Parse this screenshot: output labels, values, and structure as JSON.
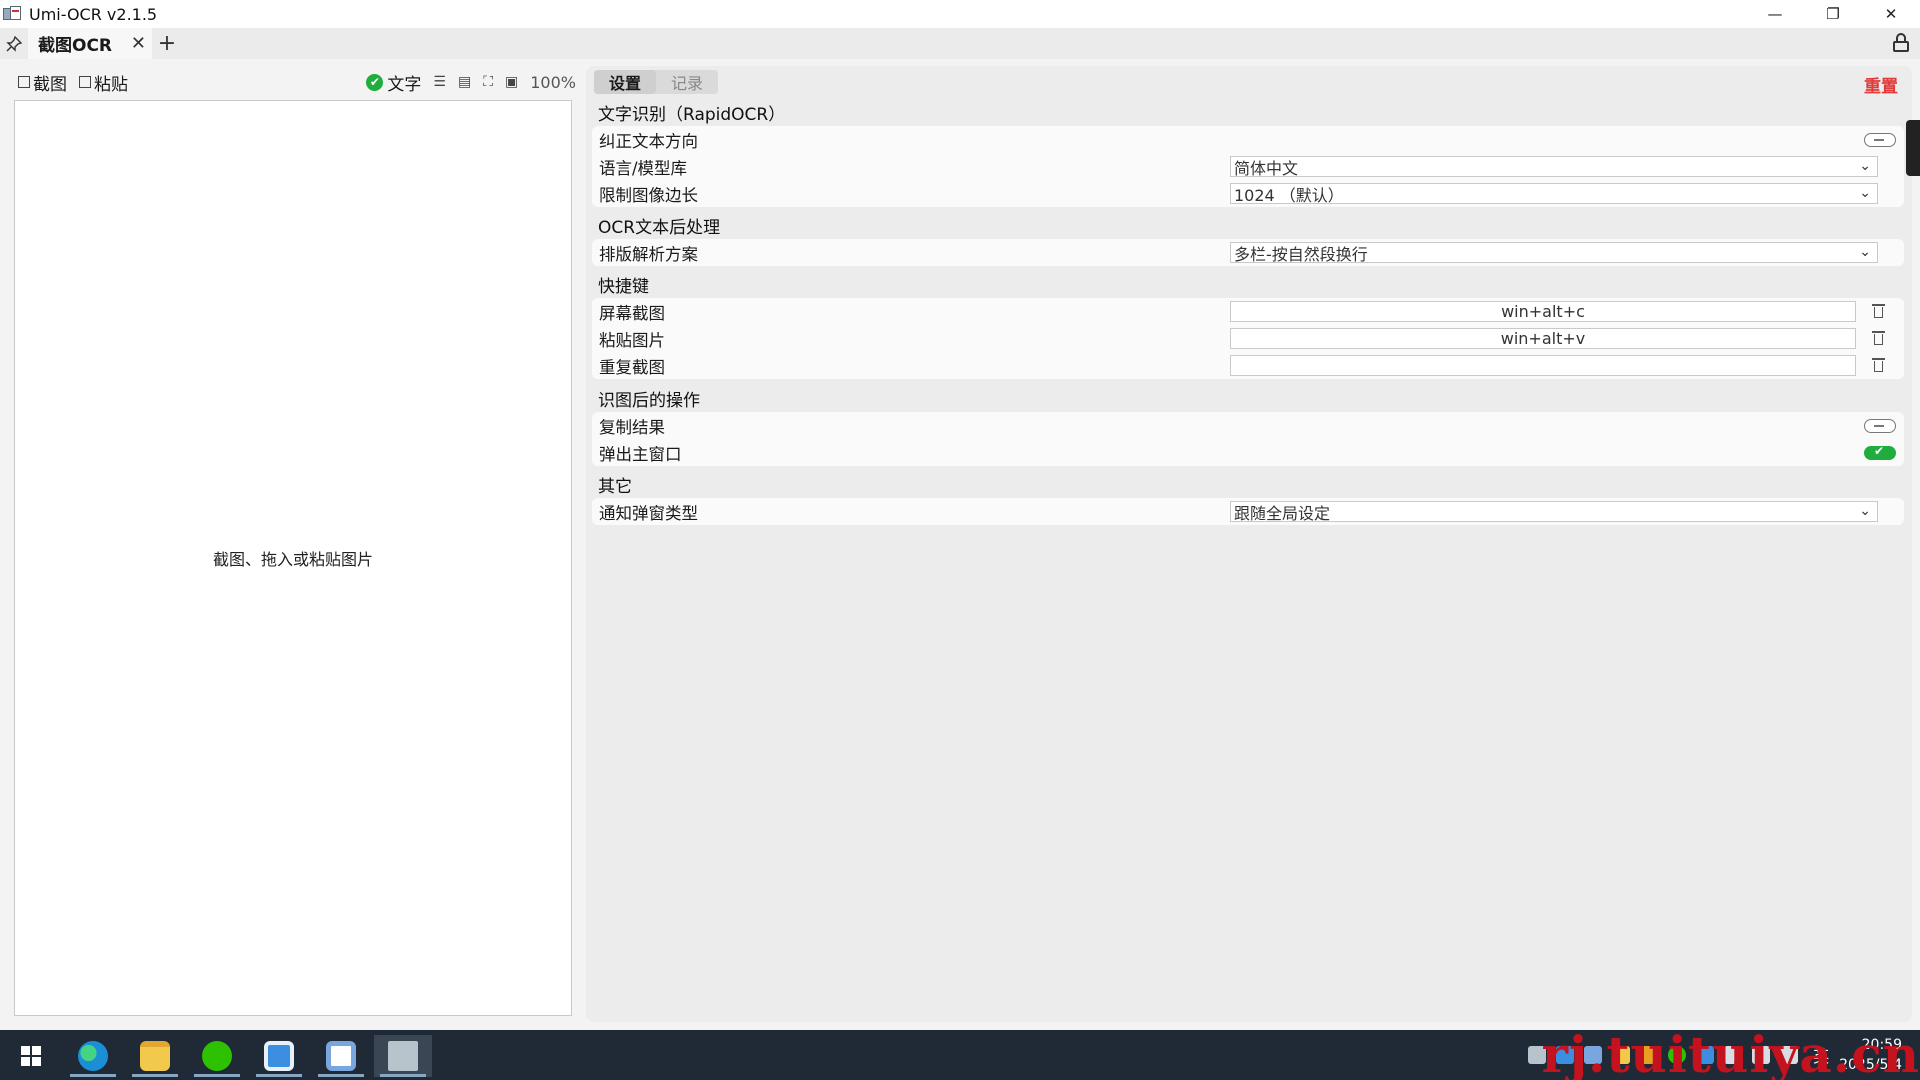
{
  "window": {
    "title": "Umi-OCR v2.1.5",
    "controls": {
      "minimize": "—",
      "restore": "❐",
      "close": "✕"
    }
  },
  "tabs": {
    "pin_icon": "📌",
    "active_tab": "截图OCR",
    "close_icon": "✕",
    "add_icon": "+"
  },
  "left": {
    "screenshot_label": "截图",
    "paste_label": "粘贴",
    "text_label": "文字",
    "zoom": "100%",
    "hint": "截图、拖入或粘贴图片"
  },
  "right": {
    "tab_settings": "设置",
    "tab_records": "记录",
    "reset": "重置",
    "sections": {
      "ocr": "文字识别（RapidOCR）",
      "post": "OCR文本后处理",
      "hotkeys": "快捷键",
      "after": "识图后的操作",
      "other": "其它"
    },
    "ocr": {
      "correct_dir_label": "纠正文本方向",
      "correct_dir_on": false,
      "lang_label": "语言/模型库",
      "lang_value": "简体中文",
      "limit_label": "限制图像边长",
      "limit_value": "1024 （默认）"
    },
    "post": {
      "layout_label": "排版解析方案",
      "layout_value": "多栏-按自然段换行"
    },
    "hotkeys": {
      "screenshot_label": "屏幕截图",
      "screenshot_value": "win+alt+c",
      "paste_label": "粘贴图片",
      "paste_value": "win+alt+v",
      "repeat_label": "重复截图",
      "repeat_value": ""
    },
    "after": {
      "copy_label": "复制结果",
      "copy_on": false,
      "popup_label": "弹出主窗口",
      "popup_on": true
    },
    "other": {
      "notify_label": "通知弹窗类型",
      "notify_value": "跟随全局设定"
    }
  },
  "taskbar": {
    "ime": "英",
    "time": "20:59",
    "date": "2025/5/4",
    "watermark": "rj.tuituiya.cn",
    "colors": {
      "edge": "#1a8fd6",
      "explorer": "#f2c94c",
      "wechat": "#2dc100",
      "app4": "#3c8fe0",
      "app5": "#ffffff"
    }
  }
}
